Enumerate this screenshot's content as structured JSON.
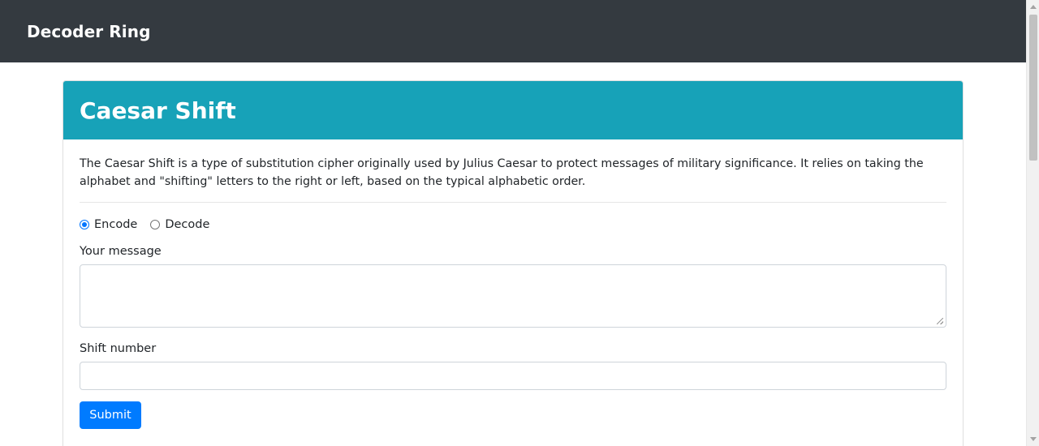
{
  "navbar": {
    "brand": "Decoder Ring"
  },
  "card": {
    "title": "Caesar Shift",
    "description": "The Caesar Shift is a type of substitution cipher originally used by Julius Caesar to protect messages of military significance. It relies on taking the alphabet and \"shifting\" letters to the right or left, based on the typical alphabetic order.",
    "mode_options": [
      {
        "label": "Encode",
        "checked": true
      },
      {
        "label": "Decode",
        "checked": false
      }
    ],
    "message_label": "Your message",
    "message_value": "",
    "shift_label": "Shift number",
    "shift_value": "",
    "submit_label": "Submit"
  },
  "colors": {
    "navbar_bg": "#343a40",
    "header_bg": "#17a2b8",
    "button_bg": "#007bff"
  }
}
